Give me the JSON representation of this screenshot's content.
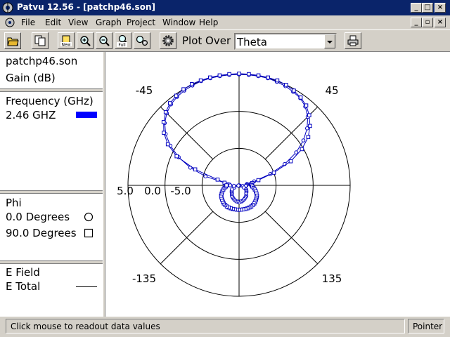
{
  "window": {
    "title": "Patvu 12.56 - [patchp46.son]"
  },
  "menu": {
    "items": [
      "File",
      "Edit",
      "View",
      "Graph",
      "Project",
      "Window",
      "Help"
    ]
  },
  "toolbar": {
    "plot_over_label": "Plot Over",
    "plot_over_value": "Theta"
  },
  "info_panel": {
    "file_name": "patchp46.son",
    "quantity": "Gain (dB)",
    "frequency_header": "Frequency (GHz)",
    "frequency_value": "2.46 GHZ",
    "frequency_color": "#0000ff",
    "phi_header": "Phi",
    "phi_items": [
      {
        "label": "0.0 Degrees",
        "marker": "circle"
      },
      {
        "label": "90.0 Degrees",
        "marker": "square"
      }
    ],
    "field_header": "E Field",
    "field_item": "E Total"
  },
  "chart_data": {
    "type": "polar",
    "angle_labels": [
      "-45",
      "45",
      "-135",
      "135"
    ],
    "radial_labels": [
      "5.0",
      "0.0",
      "-5.0"
    ],
    "series": [
      {
        "name": "0.0 Degrees",
        "marker": "circle",
        "theta_deg": [
          -90,
          -85,
          -80,
          -75,
          -70,
          -65,
          -60,
          -55,
          -50,
          -45,
          -40,
          -35,
          -30,
          -25,
          -20,
          -15,
          -10,
          -5,
          0,
          5,
          10,
          15,
          20,
          25,
          30,
          35,
          40,
          45,
          50,
          55,
          60,
          65,
          70,
          75,
          80,
          85,
          90,
          95,
          100,
          105,
          110,
          115,
          120,
          125,
          130,
          135,
          140,
          145,
          150,
          155,
          160,
          165,
          170,
          175,
          180,
          185,
          190,
          195,
          200,
          205,
          210,
          215,
          220,
          225,
          230,
          235,
          240,
          245,
          250,
          255,
          260,
          265,
          270
        ],
        "gain_db": [
          -6.3,
          -6.2,
          -5.5,
          -2.8,
          -0.5,
          1.5,
          3.2,
          4.6,
          5.6,
          6.3,
          6.8,
          7.1,
          7.3,
          7.4,
          7.5,
          7.5,
          7.5,
          7.5,
          7.5,
          7.5,
          7.5,
          7.5,
          7.4,
          7.3,
          7.1,
          6.9,
          6.4,
          5.6,
          4.5,
          3.1,
          1.4,
          -0.7,
          -3,
          -5.4,
          -6.4,
          -6.5,
          -6.5,
          -6.6,
          -7,
          -7.8,
          -7.4,
          -6.8,
          -6.4,
          -6.3,
          -6.2,
          -6.1,
          -6,
          -5.8,
          -5.7,
          -5.6,
          -5.5,
          -5.4,
          -5.3,
          -5.3,
          -5.2,
          -5.3,
          -5.3,
          -5.4,
          -5.5,
          -5.6,
          -5.7,
          -5.8,
          -6,
          -6.1,
          -6.2,
          -6.3,
          -6.4,
          -6.8,
          -7.4,
          -7.8,
          -7.4,
          -6.8,
          -6.3
        ]
      },
      {
        "name": "90.0 Degrees",
        "marker": "square",
        "theta_deg": [
          -90,
          -85,
          -80,
          -75,
          -70,
          -65,
          -60,
          -55,
          -50,
          -45,
          -40,
          -35,
          -30,
          -25,
          -20,
          -15,
          -10,
          -5,
          0,
          5,
          10,
          15,
          20,
          25,
          30,
          35,
          40,
          45,
          50,
          55,
          60,
          65,
          70,
          75,
          80,
          85,
          90,
          95,
          100,
          105,
          110,
          115,
          120,
          125,
          130,
          135,
          140,
          145,
          150,
          155,
          160,
          165,
          170,
          175,
          180,
          185,
          190,
          195,
          200,
          205,
          210,
          215,
          220,
          225,
          230,
          235,
          240,
          245,
          250,
          255,
          260,
          265,
          270
        ],
        "gain_db": [
          -5.8,
          -5.8,
          -5.5,
          -4.5,
          -1.2,
          1.8,
          3.6,
          4.9,
          5.8,
          6.5,
          7,
          7.3,
          7.5,
          7.6,
          7.6,
          7.6,
          7.6,
          7.6,
          7.6,
          7.6,
          7.6,
          7.6,
          7.6,
          7.5,
          7.3,
          7,
          6.6,
          5.9,
          5,
          3.9,
          2.3,
          0.2,
          -2.5,
          -4.8,
          -5.7,
          -5.9,
          -5.8,
          -5.7,
          -5.5,
          -5.3,
          -5.1,
          -4.9,
          -4.7,
          -4.6,
          -4.5,
          -4.4,
          -4.3,
          -4.25,
          -4.2,
          -4.2,
          -4.2,
          -4.2,
          -4.2,
          -4.2,
          -4.2,
          -4.2,
          -4.2,
          -4.2,
          -4.2,
          -4.2,
          -4.2,
          -4.25,
          -4.3,
          -4.4,
          -4.5,
          -4.6,
          -4.7,
          -4.9,
          -5.1,
          -5.3,
          -5.5,
          -5.7,
          -5.8
        ]
      }
    ]
  },
  "statusbar": {
    "message": "Click mouse to readout data values",
    "mode": "Pointer"
  }
}
